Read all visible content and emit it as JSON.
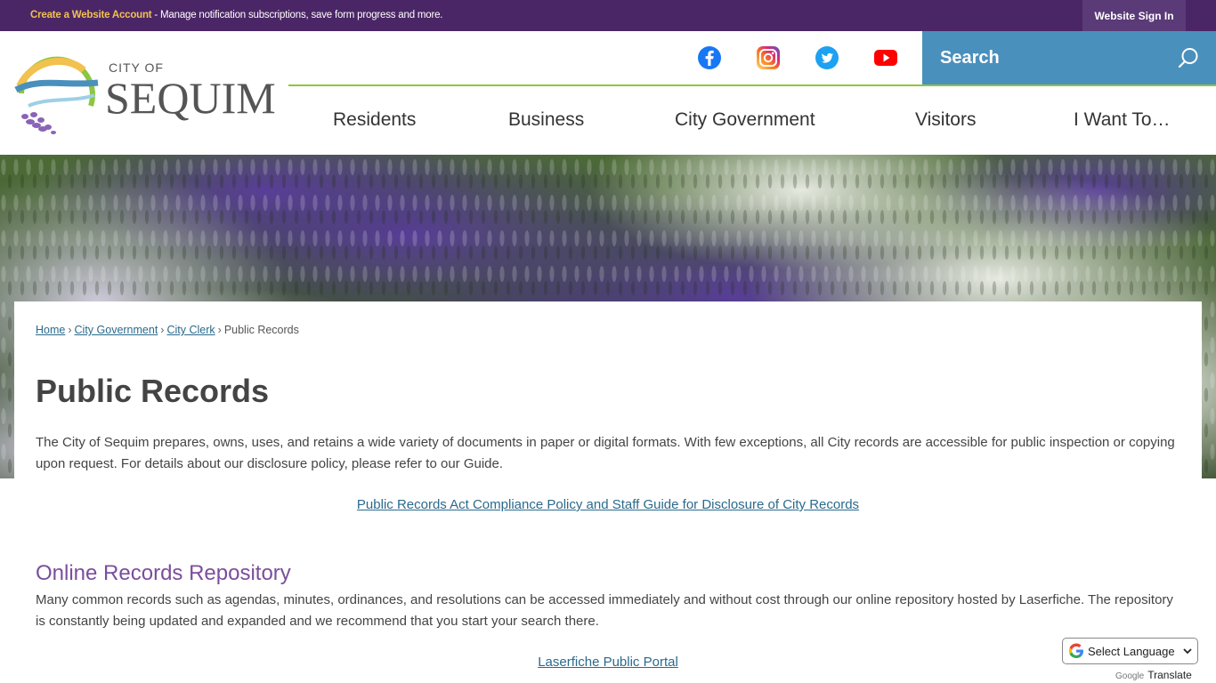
{
  "topbar": {
    "create_account": "Create a Website Account",
    "notice": " - Manage notification subscriptions, save form progress and more.",
    "signin": "Website Sign In"
  },
  "header": {
    "logo_city_of": "CITY OF",
    "logo_name": "SEQUIM",
    "search_placeholder": "Search",
    "nav": [
      {
        "label": "Residents"
      },
      {
        "label": "Business"
      },
      {
        "label": "City Government"
      },
      {
        "label": "Visitors"
      },
      {
        "label": "I Want To…"
      }
    ]
  },
  "breadcrumb": {
    "home": "Home",
    "city_government": "City Government",
    "city_clerk": "City Clerk",
    "current": "Public Records",
    "separator": "›"
  },
  "main": {
    "title": "Public Records",
    "intro": "The City of Sequim prepares, owns, uses, and retains a wide variety of documents in paper or digital formats. With few exceptions, all City records are accessible for public inspection or copying upon request. For details about our disclosure policy, please refer to our Guide.",
    "policy_link": " Public Records Act Compliance Policy and Staff Guide for Disclosure of City Records",
    "section_title": "Online Records Repository",
    "section_text": "Many common records such as agendas, minutes, ordinances, and resolutions can be accessed immediately and without cost through our online repository hosted by Laserfiche. The repository is constantly being updated and expanded and we recommend that you start your search there.",
    "portal_link": "Laserfiche Public Portal"
  },
  "translate": {
    "select_label": "Select Language",
    "powered_google": "Google",
    "powered_text": "Translate"
  },
  "colors": {
    "topbar": "#4b2666",
    "search": "#4a90bd",
    "nav_line": "#8dc63f",
    "section_title": "#7b4e9c",
    "link": "#2a6a8c"
  }
}
